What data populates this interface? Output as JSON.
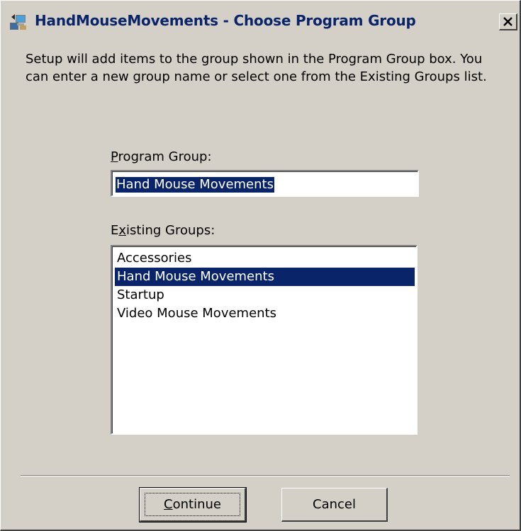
{
  "window": {
    "title": "HandMouseMovements - Choose Program Group"
  },
  "intro": {
    "text": "Setup will add items to the group shown in the Program Group box. You can enter a new group name or select one from the Existing Groups list."
  },
  "program_group": {
    "label_accel": "P",
    "label_rest": "rogram Group:",
    "value": "Hand Mouse Movements"
  },
  "existing_groups": {
    "label_pre": "E",
    "label_accel": "x",
    "label_rest": "isting Groups:",
    "items": [
      {
        "label": "Accessories",
        "selected": false
      },
      {
        "label": "Hand Mouse Movements",
        "selected": true
      },
      {
        "label": "Startup",
        "selected": false
      },
      {
        "label": "Video Mouse Movements",
        "selected": false
      }
    ]
  },
  "buttons": {
    "continue_accel": "C",
    "continue_rest": "ontinue",
    "cancel": "Cancel"
  },
  "icons": {
    "app": "setup-program-icon",
    "close": "close-icon"
  },
  "colors": {
    "face": "#d4d0c8",
    "title_text": "#0a246a",
    "selection": "#0a246a"
  }
}
